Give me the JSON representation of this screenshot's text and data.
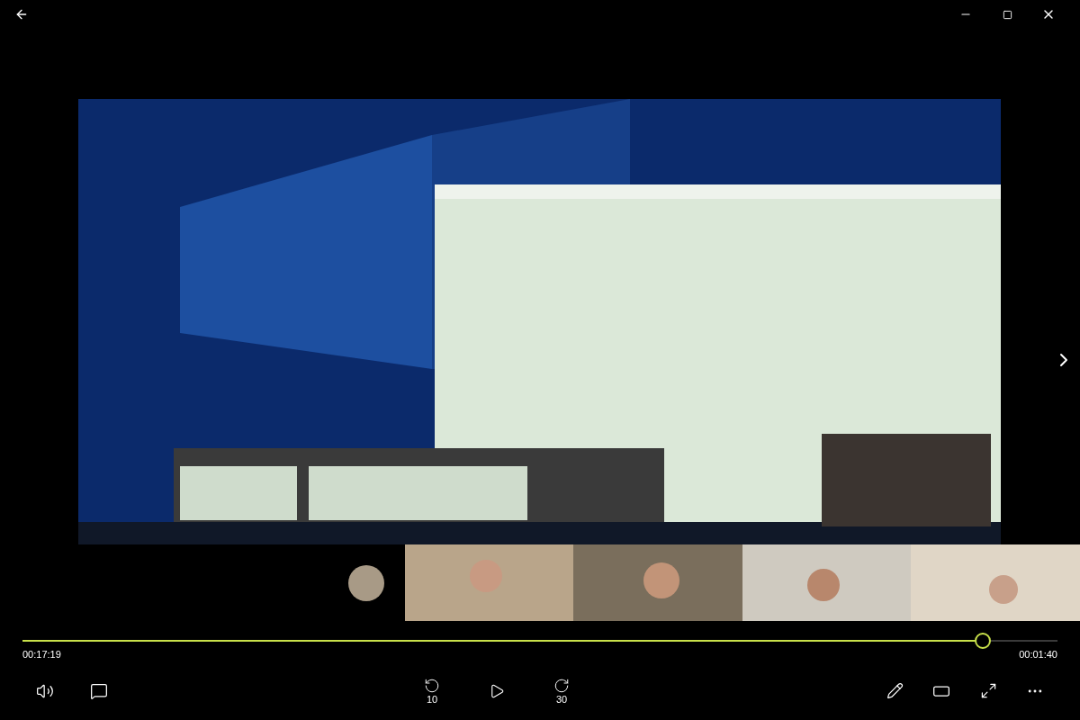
{
  "progress": {
    "level": 0.928,
    "elapsed": "00:17:19",
    "remaining": "00:01:40"
  },
  "controls": {
    "skip_back": "10",
    "skip_forward": "30"
  }
}
